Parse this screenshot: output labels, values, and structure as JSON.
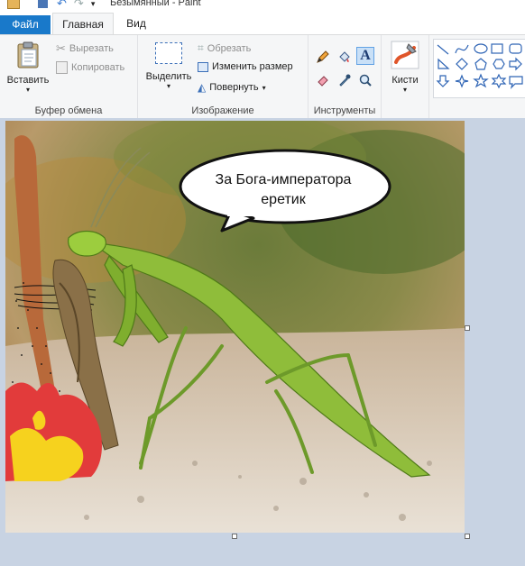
{
  "window": {
    "title": "Безымянный - Paint"
  },
  "tabs": {
    "file": "Файл",
    "home": "Главная",
    "view": "Вид"
  },
  "clipboard": {
    "paste": "Вставить",
    "cut": "Вырезать",
    "copy": "Копировать",
    "label": "Буфер обмена"
  },
  "image_group": {
    "select": "Выделить",
    "crop": "Обрезать",
    "resize": "Изменить размер",
    "rotate": "Повернуть",
    "label": "Изображение"
  },
  "tools_group": {
    "label": "Инструменты"
  },
  "brushes": {
    "label": "Кисти"
  },
  "shapes": {
    "icons": [
      "line",
      "curve",
      "oval",
      "rectangle",
      "rounded-rectangle",
      "polygon",
      "triangle",
      "right-triangle",
      "diamond",
      "pentagon",
      "hexagon",
      "right-arrow",
      "left-arrow",
      "up-arrow",
      "down-arrow",
      "four-point-star",
      "five-point-star",
      "six-point-star",
      "speech-bubble"
    ]
  },
  "canvas": {
    "speech_bubble_text_line1": "За Бога-императора",
    "speech_bubble_text_line2": "еретик"
  },
  "colors": {
    "file_tab": "#1979ca",
    "ribbon": "#f5f6f7",
    "workspace": "#c8d3e3",
    "accent": "#1979ca"
  }
}
